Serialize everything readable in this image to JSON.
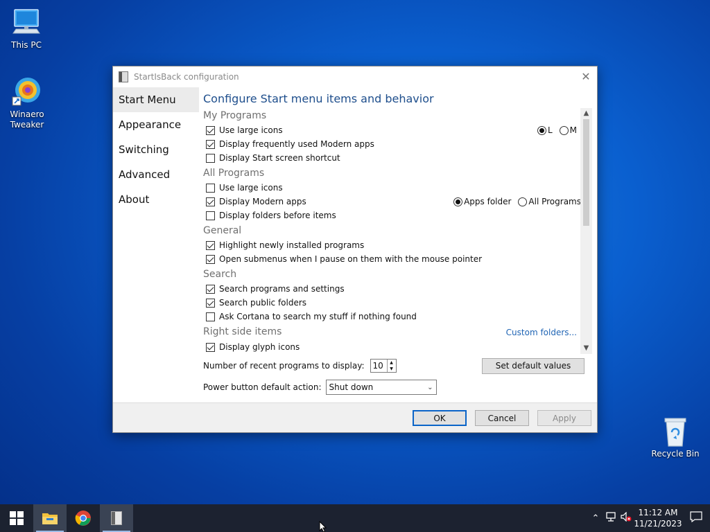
{
  "desktop": {
    "icons": [
      {
        "label": "This PC",
        "icon": "computer-icon"
      },
      {
        "label": "Winaero\nTweaker",
        "icon": "winaero-tweaker-icon"
      },
      {
        "label": "Recycle Bin",
        "icon": "recycle-bin-icon"
      }
    ]
  },
  "window": {
    "title": "StartIsBack configuration",
    "close_label": "✕",
    "nav": [
      "Start Menu",
      "Appearance",
      "Switching",
      "Advanced",
      "About"
    ],
    "heading": "Configure Start menu items and behavior",
    "sections": {
      "my_programs": {
        "title": "My Programs",
        "items": [
          {
            "label": "Use large icons",
            "checked": true
          },
          {
            "label": "Display frequently used Modern apps",
            "checked": true
          },
          {
            "label": "Display Start screen shortcut",
            "checked": false
          }
        ],
        "size_radio": {
          "options": [
            "L",
            "M"
          ],
          "selected": "L"
        }
      },
      "all_programs": {
        "title": "All Programs",
        "items": [
          {
            "label": "Use large icons",
            "checked": false
          },
          {
            "label": "Display Modern apps",
            "checked": true
          },
          {
            "label": "Display folders before items",
            "checked": false
          }
        ],
        "modern_apps_radio": {
          "options": [
            "Apps folder",
            "All Programs"
          ],
          "selected": "Apps folder"
        }
      },
      "general": {
        "title": "General",
        "items": [
          {
            "label": "Highlight newly installed programs",
            "checked": true
          },
          {
            "label": "Open submenus when I pause on them with the mouse pointer",
            "checked": true
          }
        ]
      },
      "search": {
        "title": "Search",
        "items": [
          {
            "label": "Search programs and settings",
            "checked": true
          },
          {
            "label": "Search public folders",
            "checked": true
          },
          {
            "label": "Ask Cortana to search my stuff if nothing found",
            "checked": false
          }
        ]
      },
      "right_side": {
        "title": "Right side items",
        "link": "Custom folders...",
        "items": [
          {
            "label": "Display glyph icons",
            "checked": true
          }
        ]
      }
    },
    "recent_programs": {
      "label": "Number of recent programs to display:",
      "value": "10"
    },
    "set_default_label": "Set default values",
    "power_button": {
      "label": "Power button default action:",
      "value": "Shut down"
    },
    "buttons": {
      "ok": "OK",
      "cancel": "Cancel",
      "apply": "Apply"
    }
  },
  "taskbar": {
    "clock_time": "11:12 AM",
    "clock_date": "11/21/2023"
  },
  "colors": {
    "accent": "#0a64c8",
    "link": "#1f64b4",
    "heading": "#1e4e8c"
  }
}
